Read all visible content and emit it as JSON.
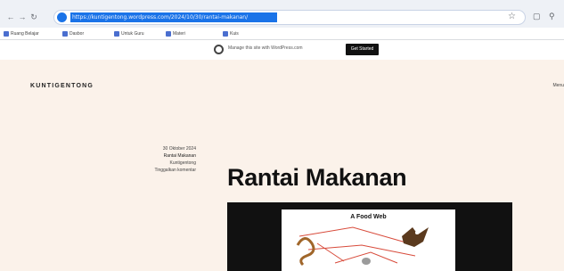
{
  "browser": {
    "url": "https://kuntigentong.wordpress.com/2024/10/30/rantai-makanan/",
    "bookmarks": [
      "Ruang Belajar",
      "Dasbor",
      "Untuk Guru",
      "Materi",
      "Kuis"
    ]
  },
  "wp_notice": {
    "text": "Manage this site with WordPress.com",
    "button": "Get Started"
  },
  "site": {
    "title": "KUNTIGENTONG",
    "nav_label": "Menu"
  },
  "post": {
    "title": "Rantai Makanan",
    "meta": {
      "date": "30 Oktober 2024",
      "author": "Kuntigentong",
      "categories": "Rantai Makanan",
      "comments": "Tinggalkan komentar"
    },
    "featured_image": {
      "caption_title": "A Food Web"
    }
  }
}
